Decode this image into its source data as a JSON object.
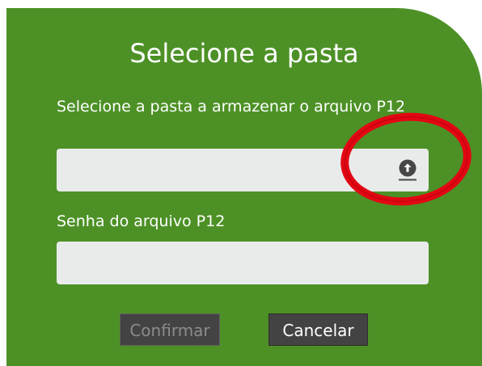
{
  "dialog": {
    "title": "Selecione a pasta",
    "folder_label": "Selecione a pasta a armazenar o arquivo P12",
    "folder_value": "",
    "upload_icon": "upload-circle-icon",
    "password_label": "Senha do arquivo P12",
    "password_value": "",
    "confirm_label": "Confirmar",
    "cancel_label": "Cancelar"
  },
  "colors": {
    "panel": "#4d9126",
    "field": "#e9ebeb",
    "button": "#434343",
    "highlight": "#e30613"
  }
}
